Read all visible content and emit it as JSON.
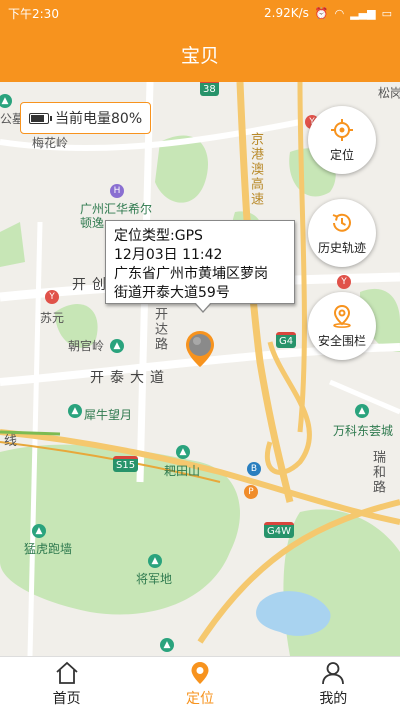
{
  "status_bar": {
    "time": "下午2:30",
    "speed": "2.92K/s",
    "battery": ""
  },
  "app_bar": {
    "title": "宝贝"
  },
  "battery_badge": {
    "text": "当前电量80%",
    "level_percent": 80
  },
  "map_labels": {
    "meihualing": "梅花岭",
    "hotel": "广州汇华希尔顿逸",
    "kaichuang": "开创",
    "suyuan": "苏元",
    "chaoguanling": "朝官岭",
    "kaida_road": "开达路",
    "kaitai_road": "开泰大道",
    "xiniu": "犀牛望月",
    "batianshan": "耙田山",
    "menghu": "猛虎跑墙",
    "jiangjun": "将军地",
    "wanke": "万科东荟城",
    "ruihe": "瑞和路",
    "songyuan": "松岗",
    "gongyu": "公墓",
    "jinggang": "京港澳高速",
    "line": "线",
    "s15": "S15",
    "g4": "G4",
    "g4w": "G4W",
    "g3": "38"
  },
  "fabs": {
    "locate": "定位",
    "history": "历史轨迹",
    "fence": "安全围栏"
  },
  "info_window": {
    "line1": "定位类型:GPS",
    "line2": "12月03日 11:42",
    "line3": "广东省广州市黄埔区萝岗",
    "line4": "街道开泰大道59号"
  },
  "tabs": [
    {
      "label": "首页",
      "icon": "home-icon"
    },
    {
      "label": "定位",
      "icon": "location-pin-icon"
    },
    {
      "label": "我的",
      "icon": "user-icon"
    }
  ],
  "colors": {
    "accent": "#f7931e",
    "park": "#c7e6b6",
    "water": "#a9d3f0",
    "highway": "#f5c86e"
  }
}
